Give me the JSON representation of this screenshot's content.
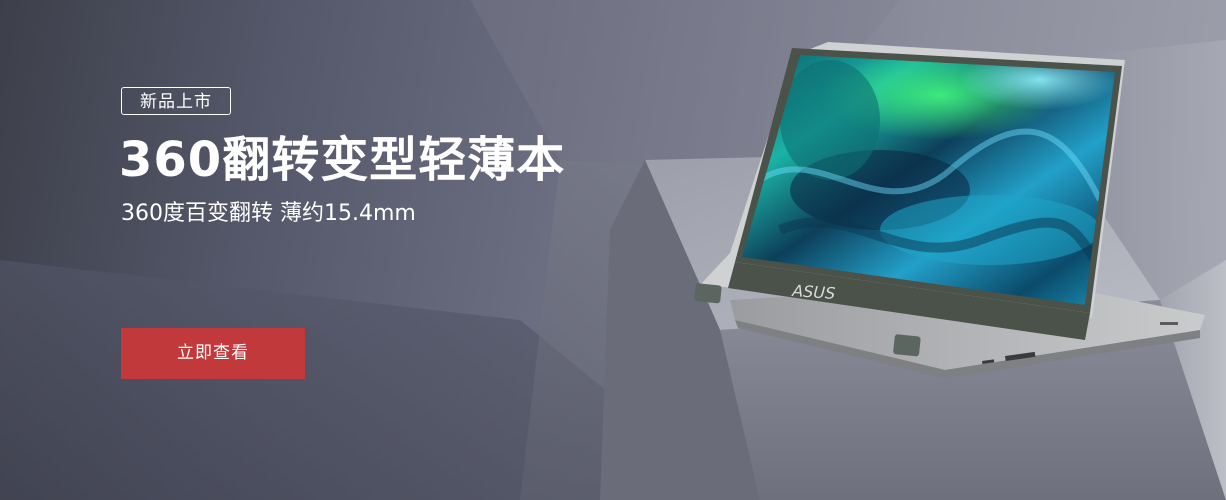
{
  "banner": {
    "badge": "新品上市",
    "title": "360翻转变型轻薄本",
    "subtitle": "360度百变翻转 薄约15.4mm",
    "cta_label": "立即查看",
    "laptop_brand": "ASUS"
  },
  "colors": {
    "cta_background": "#c1393b",
    "text": "#ffffff",
    "background": "#6b6e80"
  },
  "icons": [
    "laptop-image"
  ]
}
